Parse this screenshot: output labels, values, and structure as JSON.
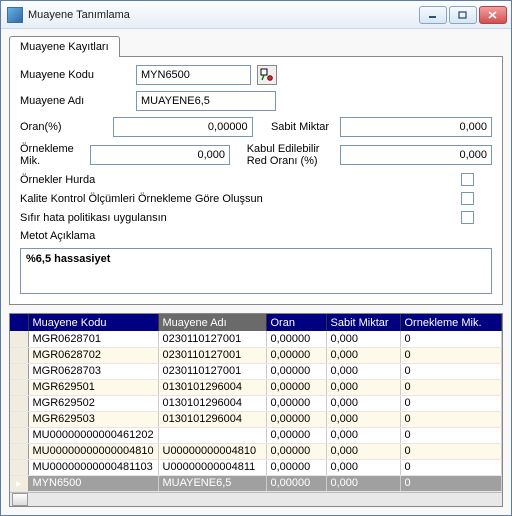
{
  "window": {
    "title": "Muayene Tanımlama"
  },
  "tabs": [
    {
      "label": "Muayene Kayıtları"
    }
  ],
  "form": {
    "kodu_label": "Muayene Kodu",
    "kodu_value": "MYN6500",
    "adi_label": "Muayene Adı",
    "adi_value": "MUAYENE6,5",
    "oran_label": "Oran(%)",
    "oran_value": "0,00000",
    "sabit_label": "Sabit Miktar",
    "sabit_value": "0,000",
    "orneklem_label": "Örnekleme Mik.",
    "orneklem_value": "0,000",
    "kabul_label": "Kabul Edilebilir Red Oranı (%)",
    "kabul_value": "0,000",
    "chk1_label": "Örnekler Hurda",
    "chk2_label": "Kalite Kontrol Ölçümleri Örnekleme Göre Oluşsun",
    "chk3_label": "Sıfır hata politikası uygulansın",
    "metot_label": "Metot Açıklama",
    "metot_value": "%6,5 hassasiyet"
  },
  "grid": {
    "headers": [
      "Muayene Kodu",
      "Muayene Adı",
      "Oran",
      "Sabit Miktar",
      "Ornekleme Mik."
    ],
    "rows": [
      {
        "kodu": "MGR0628701",
        "adi": "0230110127001",
        "oran": "0,00000",
        "sabit": "0,000",
        "orn": "0"
      },
      {
        "kodu": "MGR0628702",
        "adi": "0230110127001",
        "oran": "0,00000",
        "sabit": "0,000",
        "orn": "0"
      },
      {
        "kodu": "MGR0628703",
        "adi": "0230110127001",
        "oran": "0,00000",
        "sabit": "0,000",
        "orn": "0"
      },
      {
        "kodu": "MGR629501",
        "adi": "0130101296004",
        "oran": "0,00000",
        "sabit": "0,000",
        "orn": "0"
      },
      {
        "kodu": "MGR629502",
        "adi": "0130101296004",
        "oran": "0,00000",
        "sabit": "0,000",
        "orn": "0"
      },
      {
        "kodu": "MGR629503",
        "adi": "0130101296004",
        "oran": "0,00000",
        "sabit": "0,000",
        "orn": "0"
      },
      {
        "kodu": "MU00000000000461202",
        "adi": "",
        "oran": "0,00000",
        "sabit": "0,000",
        "orn": "0"
      },
      {
        "kodu": "MU00000000000004810",
        "adi": "U00000000004810",
        "oran": "0,00000",
        "sabit": "0,000",
        "orn": "0"
      },
      {
        "kodu": "MU00000000000481103",
        "adi": "U00000000004811",
        "oran": "0,00000",
        "sabit": "0,000",
        "orn": "0"
      },
      {
        "kodu": "MYN6500",
        "adi": "MUAYENE6,5",
        "oran": "0,00000",
        "sabit": "0,000",
        "orn": "0",
        "selected": true
      }
    ]
  }
}
